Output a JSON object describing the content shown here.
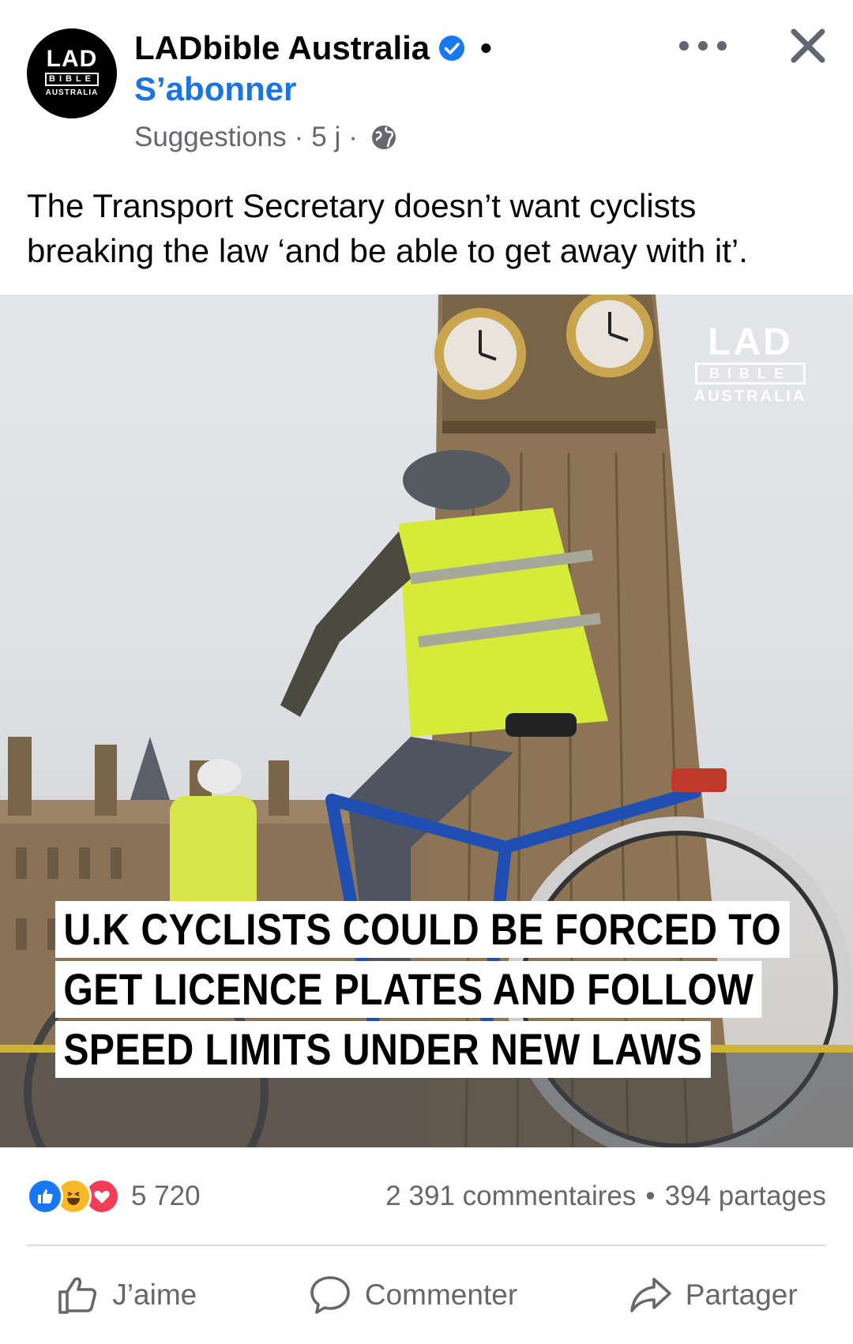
{
  "header": {
    "page_name": "LADbible Australia",
    "dot": "•",
    "follow_label": "S’abonner",
    "meta_source": "Suggestions",
    "meta_time": "5 j",
    "meta_sep": "·",
    "avatar_logo": {
      "line1": "LAD",
      "line2": "BIBLE",
      "line3": "AUSTRALIA"
    },
    "icons": {
      "verified": "verified-badge-icon",
      "privacy": "globe-icon",
      "more": "more-options-icon",
      "close": "close-icon"
    },
    "accent_color": "#1b74e4"
  },
  "post": {
    "text": "The Transport Secretary doesn’t want cyclists breaking the law ‘and be able to get away with it’.",
    "image": {
      "watermark": {
        "line1": "LAD",
        "line2": "BIBLE",
        "line3": "AUSTRALIA"
      },
      "headline_lines": [
        "U.K CYCLISTS COULD BE FORCED TO",
        "GET LICENCE PLATES AND FOLLOW",
        "SPEED LIMITS UNDER NEW LAWS"
      ]
    }
  },
  "engagement": {
    "reaction_icons": [
      "like-reaction-icon",
      "haha-reaction-icon",
      "love-reaction-icon"
    ],
    "reaction_count": "5 720",
    "comments": "2 391 commentaires",
    "bullet": "•",
    "shares": "394 partages"
  },
  "actions": {
    "like_label": "J’aime",
    "comment_label": "Commenter",
    "share_label": "Partager"
  }
}
